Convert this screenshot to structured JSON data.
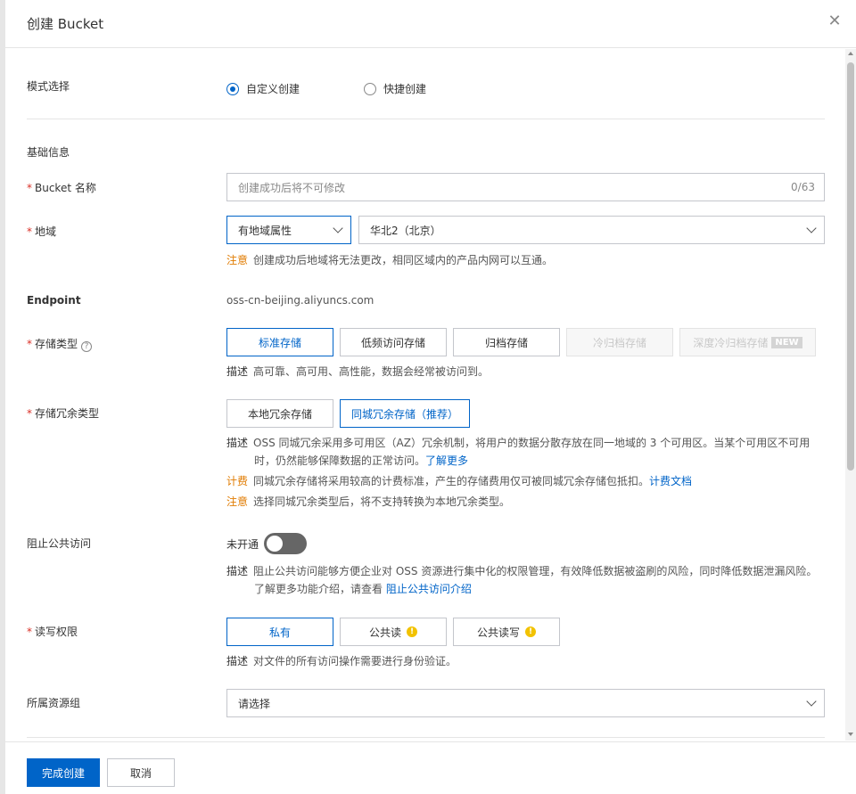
{
  "dialog": {
    "title": "创建 Bucket",
    "close_icon": "close-icon"
  },
  "mode": {
    "label": "模式选择",
    "options": [
      {
        "label": "自定义创建",
        "checked": true
      },
      {
        "label": "快捷创建",
        "checked": false
      }
    ]
  },
  "basic_info": {
    "heading": "基础信息"
  },
  "bucket_name": {
    "required": "*",
    "label": "Bucket 名称",
    "placeholder": "创建成功后将不可修改",
    "count": "0/63"
  },
  "region": {
    "required": "*",
    "label": "地域",
    "type_value": "有地域属性",
    "region_value": "华北2（北京）",
    "note_tag": "注意",
    "note_text": "创建成功后地域将无法更改，相同区域内的产品内网可以互通。"
  },
  "endpoint": {
    "label": "Endpoint",
    "value": "oss-cn-beijing.aliyuncs.com"
  },
  "storage_class": {
    "required": "*",
    "label": "存储类型",
    "help_icon": "?",
    "options": [
      {
        "label": "标准存储",
        "state": "selected"
      },
      {
        "label": "低频访问存储",
        "state": "normal"
      },
      {
        "label": "归档存储",
        "state": "normal"
      },
      {
        "label": "冷归档存储",
        "state": "disabled"
      },
      {
        "label": "深度冷归档存储",
        "state": "disabled",
        "badge": "NEW"
      }
    ],
    "desc_tag": "描述",
    "desc_text": "高可靠、高可用、高性能，数据会经常被访问到。"
  },
  "redundancy": {
    "required": "*",
    "label": "存储冗余类型",
    "options": [
      {
        "label": "本地冗余存储",
        "state": "normal"
      },
      {
        "label": "同城冗余存储（推荐）",
        "state": "selected"
      }
    ],
    "desc_tag": "描述",
    "desc_line1": "OSS 同城冗余采用多可用区（AZ）冗余机制，将用户的数据分散存放在同一地域的 3 个可用区。当某个可用区不可用",
    "desc_line2": "时，仍然能够保障数据的正常访问。",
    "desc_link": "了解更多",
    "billing_tag": "计费",
    "billing_text": "同城冗余存储将采用较高的计费标准，产生的存储费用仅可被同城冗余存储包抵扣。",
    "billing_link": "计费文档",
    "note_tag": "注意",
    "note_text": "选择同城冗余类型后，将不支持转换为本地冗余类型。"
  },
  "block_public": {
    "label": "阻止公共访问",
    "toggle_text": "未开通",
    "desc_tag": "描述",
    "desc_line1": "阻止公共访问能够方便企业对 OSS 资源进行集中化的权限管理，有效降低数据被盗刷的风险，同时降低数据泄漏风险。",
    "desc_line2": "了解更多功能介绍，请查看",
    "desc_link": "阻止公共访问介绍"
  },
  "acl": {
    "required": "*",
    "label": "读写权限",
    "options": [
      {
        "label": "私有",
        "state": "selected"
      },
      {
        "label": "公共读",
        "state": "normal",
        "warn": "!"
      },
      {
        "label": "公共读写",
        "state": "normal",
        "warn": "!"
      }
    ],
    "desc_tag": "描述",
    "desc_text": "对文件的所有访问操作需要进行身份验证。"
  },
  "resource_group": {
    "label": "所属资源组",
    "placeholder": "请选择"
  },
  "footer": {
    "submit": "完成创建",
    "cancel": "取消"
  },
  "colors": {
    "primary": "#0064c8",
    "warning": "#e07b00",
    "required": "#d93026"
  }
}
